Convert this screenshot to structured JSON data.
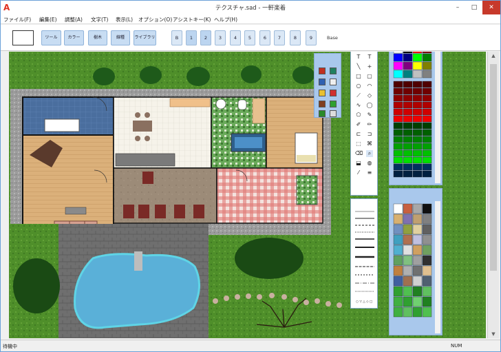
{
  "window": {
    "title": "テクスチャ.sad - 一軒楽着",
    "app_icon": "A",
    "min": "–",
    "max": "□",
    "close": "✕"
  },
  "menu": [
    "ファイル(F)",
    "編集(E)",
    "調整(A)",
    "文字(T)",
    "表示(L)",
    "オプション(O)",
    "アシストキー(K)",
    "ヘルプ(H)"
  ],
  "toolbar": {
    "buttons": [
      "ツール",
      "カラー",
      "樹木",
      "線種",
      "ライブラリ"
    ],
    "layers": [
      "B",
      "1",
      "2",
      "3",
      "4",
      "5",
      "6",
      "7",
      "8",
      "9"
    ],
    "base_label": "Base"
  },
  "status": {
    "text": "待機中",
    "num": "NUM"
  },
  "colors": {
    "accent": "#a9c8ec",
    "titlebar_close": "#c7392b"
  },
  "icons": [
    "app-icon",
    "pointer-icon",
    "text-icon",
    "line-icon",
    "rect-icon",
    "ellipse-icon",
    "pen-icon",
    "fill-icon",
    "eyedropper-icon",
    "zoom-icon"
  ]
}
